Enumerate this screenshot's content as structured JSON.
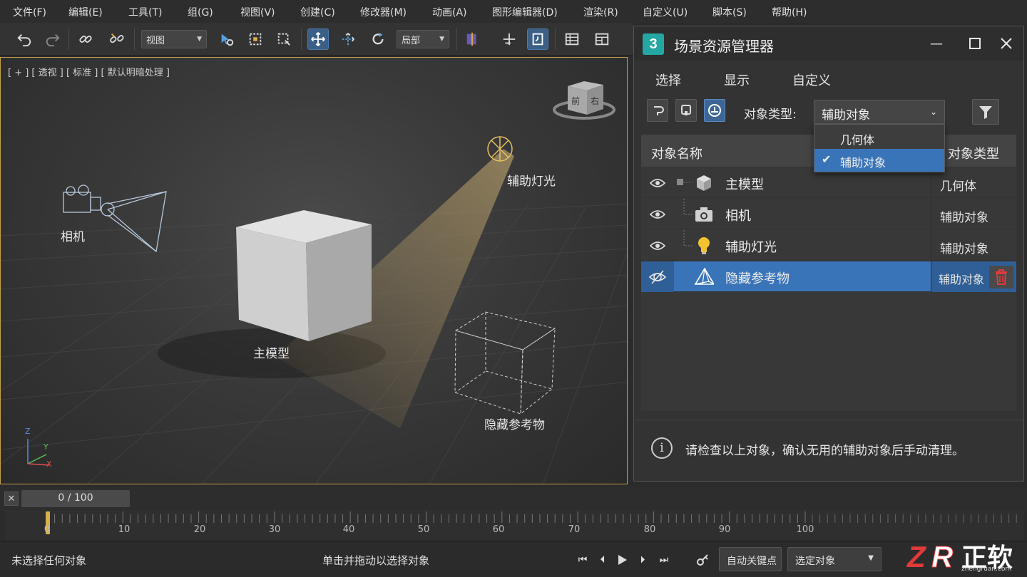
{
  "menu": [
    "文件(F)",
    "编辑(E)",
    "工具(T)",
    "组(G)",
    "视图(V)",
    "创建(C)",
    "修改器(M)",
    "动画(A)",
    "图形编辑器(D)",
    "渲染(R)",
    "自定义(U)",
    "脚本(S)",
    "帮助(H)"
  ],
  "toolbar": {
    "view_dropdown": "视图",
    "coord_dropdown": "局部",
    "icons": [
      "undo-icon",
      "redo-icon",
      "link-icon",
      "unlink-icon",
      "select-icon",
      "select-region-icon",
      "window-crossing-icon",
      "move-icon",
      "scale-icon",
      "rotate-icon",
      "mirror-icon",
      "snap-icon",
      "snap-toggle-icon",
      "layer-manager-icon",
      "scene-explorer-icon"
    ]
  },
  "viewport": {
    "label": "[ + ] [ 透视 ] [ 标准 ] [ 默认明暗处理 ]",
    "viewcube": {
      "front": "前",
      "right": "右"
    },
    "axes": {
      "x": "X",
      "y": "Y",
      "z": "Z"
    },
    "objects": {
      "camera": "相机",
      "main_model": "主模型",
      "light": "辅助灯光",
      "hidden_ref": "隐藏参考物"
    }
  },
  "scene_explorer": {
    "title": "场景资源管理器",
    "logo": "3",
    "menu": [
      "选择",
      "显示",
      "自定义"
    ],
    "type_label": "对象类型:",
    "type_selected": "辅助对象",
    "dropdown_options": [
      {
        "label": "几何体",
        "checked": false
      },
      {
        "label": "辅助对象",
        "checked": true
      }
    ],
    "col_name": "对象名称",
    "col_type": "对象类型",
    "rows": [
      {
        "name": "主模型",
        "type": "几何体",
        "icon": "box-icon",
        "visible": true,
        "selected": false
      },
      {
        "name": "相机",
        "type": "辅助对象",
        "icon": "camera-icon",
        "visible": true,
        "selected": false
      },
      {
        "name": "辅助灯光",
        "type": "辅助对象",
        "icon": "lightbulb-icon",
        "visible": true,
        "selected": false
      },
      {
        "name": "隐藏参考物",
        "type": "辅助对象",
        "icon": "pyramid-icon",
        "visible": false,
        "selected": true
      }
    ],
    "info": "请检查以上对象，确认无用的辅助对象后手动清理。"
  },
  "timeline": {
    "frame": "0 / 100",
    "ticks": [
      "0",
      "10",
      "20",
      "30",
      "40",
      "50",
      "60",
      "70",
      "80",
      "90",
      "100"
    ]
  },
  "status": {
    "selection": "未选择任何对象",
    "prompt": "单击并拖动以选择对象",
    "autokey": "自动关键点",
    "key_filter": "选定对象"
  },
  "watermark": {
    "brand": "正软",
    "url": "zhengruan.com"
  },
  "colors": {
    "accent": "#3a74b8",
    "viewport_border": "#c7a14a",
    "delete": "#e03a3a"
  }
}
